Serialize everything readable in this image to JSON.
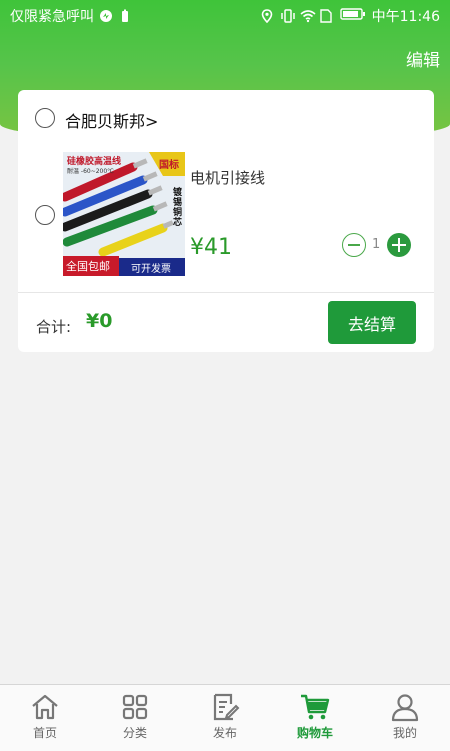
{
  "status_bar": {
    "carrier": "仅限紧急呼叫",
    "time": "中午11:46"
  },
  "header": {
    "edit_label": "编辑"
  },
  "cart": {
    "shop_name": "合肥贝斯邦>",
    "item": {
      "title": "电机引接线",
      "price": "¥41",
      "quantity": "1",
      "image_texts": {
        "top": "硅橡胶高温线",
        "temp": "耐温 -60~200℃",
        "badge": "国标",
        "side": "镀锡铜芯",
        "bottom_left": "全国包邮",
        "bottom_right": "可开发票"
      }
    },
    "total_label": "合计:",
    "total_value": "¥0",
    "checkout_label": "去结算"
  },
  "tabbar": {
    "items": [
      {
        "label": "首页",
        "icon": "home-icon"
      },
      {
        "label": "分类",
        "icon": "grid-icon"
      },
      {
        "label": "发布",
        "icon": "edit-icon"
      },
      {
        "label": "购物车",
        "icon": "cart-icon"
      },
      {
        "label": "我的",
        "icon": "user-icon"
      }
    ],
    "active_index": 3
  },
  "colors": {
    "brand_green": "#1f9a3a",
    "price_green": "#2a9a2a",
    "background": "#f2f2f2"
  }
}
